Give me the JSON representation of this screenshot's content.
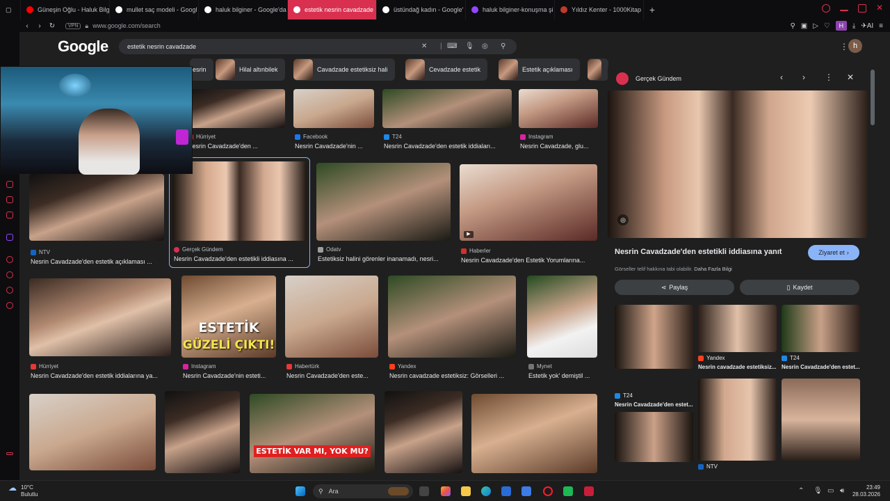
{
  "browser": {
    "tabs": [
      {
        "label": "Güneşin Oğlu - Haluk Bilgi",
        "active": false,
        "color": "#ff0000"
      },
      {
        "label": "mullet saç modeli - Googl",
        "active": false,
        "color": "#ffffff"
      },
      {
        "label": "haluk bilginer - Google'da",
        "active": false,
        "color": "#ffffff"
      },
      {
        "label": "estetik nesrin cavadzade",
        "active": true,
        "color": "#ffffff"
      },
      {
        "label": "üstündağ kadın - Google'",
        "active": false,
        "color": "#ffffff"
      },
      {
        "label": "haluk bilginer-konuşma şi",
        "active": false,
        "color": "#9146ff"
      },
      {
        "label": "Yıldız Kenter - 1000Kitap",
        "active": false,
        "color": "#c0392b"
      }
    ],
    "new_tab": "+",
    "vpn": "VPN",
    "url": "www.google.com/search",
    "profile_initial": "H",
    "ai_label": "AI"
  },
  "google": {
    "logo": "Google",
    "query": "estetik nesrin cavadzade",
    "avatar_initial": "h",
    "chips": [
      "esrin",
      "Hilal altınbilek",
      "Cavadzade estetiksiz hali",
      "Cevadzade estetik",
      "Estetik açıklaması"
    ]
  },
  "results": {
    "row1": [
      {
        "source": "Hürriyet",
        "title": "Nesrin Cavadzade'den ...",
        "color": "#e53935"
      },
      {
        "source": "Facebook",
        "title": "Nesrin Cavadzade'nin ...",
        "color": "#1877f2"
      },
      {
        "source": "T24",
        "title": "Nesrin Cavadzade'den estetik iddiaları...",
        "color": "#1e88e5"
      },
      {
        "source": "Instagram",
        "title": "Nesrin Cavadzade, glu...",
        "color": "#d6249f"
      }
    ],
    "row2": [
      {
        "source": "NTV",
        "title": "Nesrin Cavadzade'den estetik açıklaması ...",
        "color": "#1565c0"
      },
      {
        "source": "Gerçek Gündem",
        "title": "Nesrin Cavadzade'den estetikli iddiasına ...",
        "color": "#d9304f"
      },
      {
        "source": "Odatv",
        "title": "Estetiksiz halini görenler inanamadı, nesri...",
        "color": "#9e9e9e"
      },
      {
        "source": "Haberler",
        "title": "Nesrin Cavadzade'den Estetik Yorumlarına...",
        "color": "#d32f2f"
      }
    ],
    "row3": [
      {
        "source": "Hürriyet",
        "title": "Nesrin Cavadzade'den estetik iddialarına ya...",
        "color": "#e53935"
      },
      {
        "source": "Instagram",
        "title": "Nesrin Cavadzade'nin esteti...",
        "color": "#d6249f"
      },
      {
        "source": "Habertürk",
        "title": "Nesrin Cavadzade'den este...",
        "color": "#e53935"
      },
      {
        "source": "Yandex",
        "title": "Nesrin cavadzade estetiksiz: Görselleri ...",
        "color": "#fc3f1d"
      },
      {
        "source": "Mynet",
        "title": "Estetik yok' demiştil ...",
        "color": "#757575"
      }
    ],
    "overlay_estetik": "ESTETİK",
    "overlay_guzeli": "GÜZELİ ÇIKTI!",
    "overlay_varmi": "ESTETİK VAR MI, YOK MU?"
  },
  "panel": {
    "site": "Gerçek Gündem",
    "title": "Nesrin Cavadzade'den estetikli iddiasına yanıt",
    "visit": "Ziyaret et",
    "notice": "Görseller telif hakkına tabi olabilir.",
    "more_info": "Daha Fazla Bilgi",
    "share": "Paylaş",
    "save": "Kaydet",
    "related": [
      {
        "source": "Yandex",
        "title": "Nesrin cavadzade estetiksiz...",
        "color": "#fc3f1d"
      },
      {
        "source": "T24",
        "title": "Nesrin Cavadzade'den estet...",
        "color": "#1e88e5"
      },
      {
        "source": "T24",
        "title": "Nesrin Cavadzade'den estet...",
        "color": "#1e88e5"
      },
      {
        "source": "NTV",
        "title": "",
        "color": "#1565c0"
      }
    ]
  },
  "taskbar": {
    "temp": "10°C",
    "weather": "Bulutlu",
    "search_placeholder": "Ara",
    "time": "23:49",
    "date": "28.03.2026"
  }
}
